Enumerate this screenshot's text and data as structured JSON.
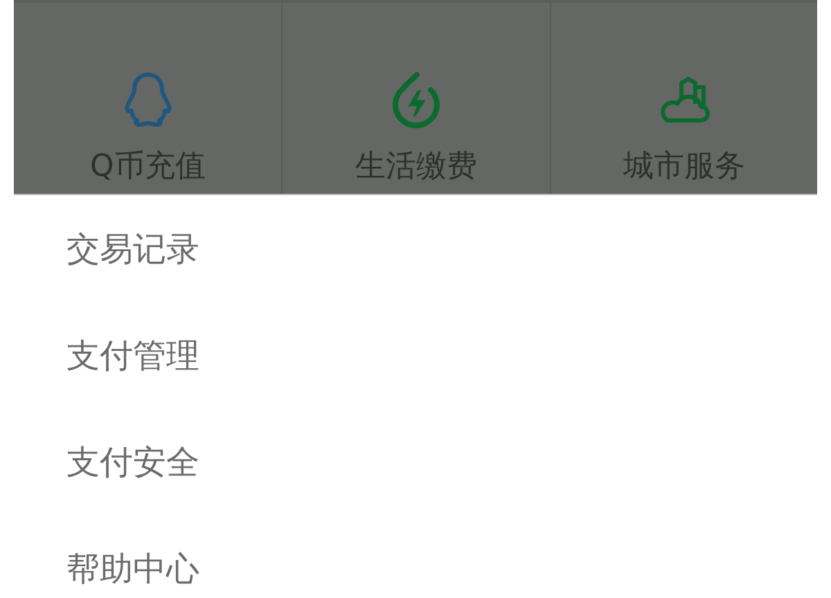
{
  "services": [
    {
      "label": "Q币充值",
      "kind": "penguin"
    },
    {
      "label": "生活缴费",
      "kind": "power"
    },
    {
      "label": "城市服务",
      "kind": "city"
    }
  ],
  "menu": [
    "交易记录",
    "支付管理",
    "支付安全",
    "帮助中心"
  ]
}
